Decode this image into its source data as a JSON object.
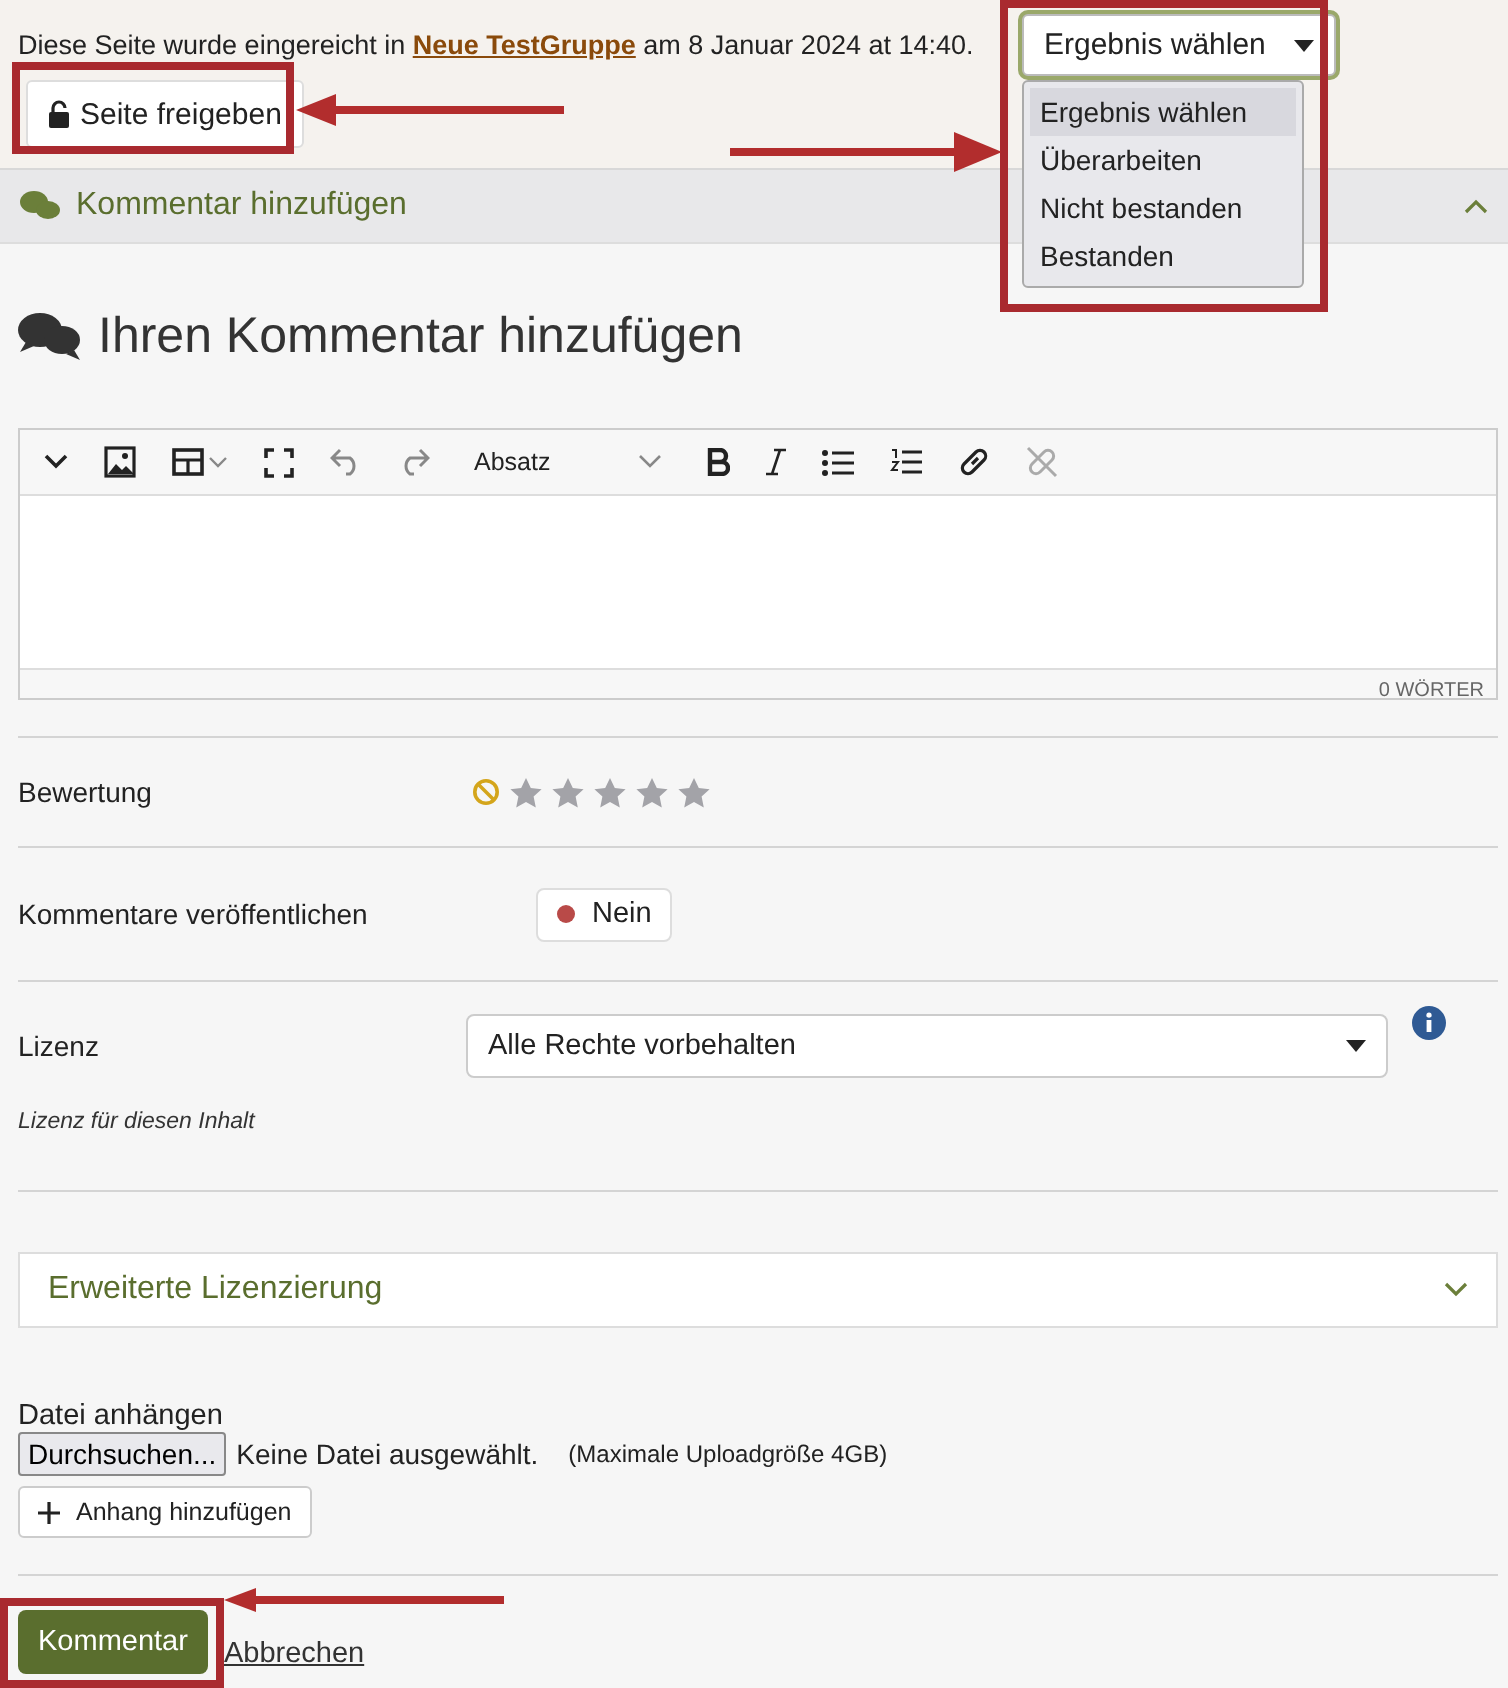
{
  "submission": {
    "text_before": "Diese Seite wurde eingereicht in",
    "group_link": "Neue TestGruppe",
    "text_after": "am 8 Januar 2024 at 14:40.",
    "release_button": "Seite freigeben",
    "result_select": {
      "value": "Ergebnis wählen",
      "expanded": true,
      "options": [
        {
          "label": "Ergebnis wählen",
          "selected": true
        },
        {
          "label": "Überarbeiten",
          "selected": false
        },
        {
          "label": "Nicht bestanden",
          "selected": false
        },
        {
          "label": "Bestanden",
          "selected": false
        }
      ]
    }
  },
  "comment_section": {
    "title": "Kommentar hinzufügen",
    "expanded": true
  },
  "heading": "Ihren Kommentar hinzufügen",
  "editor": {
    "format": "Absatz",
    "word_count": "0 WÖRTER"
  },
  "rating": {
    "label": "Bewertung",
    "stars": 0
  },
  "publish": {
    "label": "Kommentare veröffentlichen",
    "on": false,
    "value": "Nein"
  },
  "license": {
    "label": "Lizenz",
    "value": "Alle Rechte vorbehalten",
    "hint": "Lizenz für diesen Inhalt"
  },
  "advanced_license": {
    "title": "Erweiterte Lizenzierung",
    "expanded": false
  },
  "attachment": {
    "label": "Datei anhängen",
    "browse_button": "Durchsuchen...",
    "file_status": "Keine Datei ausgewählt.",
    "max_size": "(Maximale Uploadgröße 4GB)",
    "add_button": "Anhang hinzufügen"
  },
  "actions": {
    "submit": "Kommentar",
    "cancel": "Abbrechen"
  }
}
